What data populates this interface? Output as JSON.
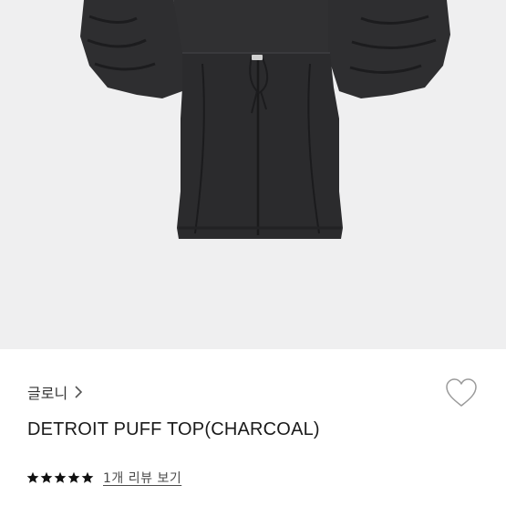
{
  "product": {
    "image_alt": "DETROIT PUFF TOP(CHARCOAL)",
    "image_background": "#efeff0",
    "garment_color": "#2b2b2d"
  },
  "brand": {
    "name": "글로니",
    "chevron_icon": "chevron-right-icon"
  },
  "title": "DETROIT PUFF TOP(CHARCOAL)",
  "like": {
    "icon": "heart-outline-icon"
  },
  "rating": {
    "stars": 5,
    "max_stars": 5,
    "star_icon": "star-icon",
    "star_color": "#111111",
    "review_link": "1개 리뷰 보기"
  }
}
